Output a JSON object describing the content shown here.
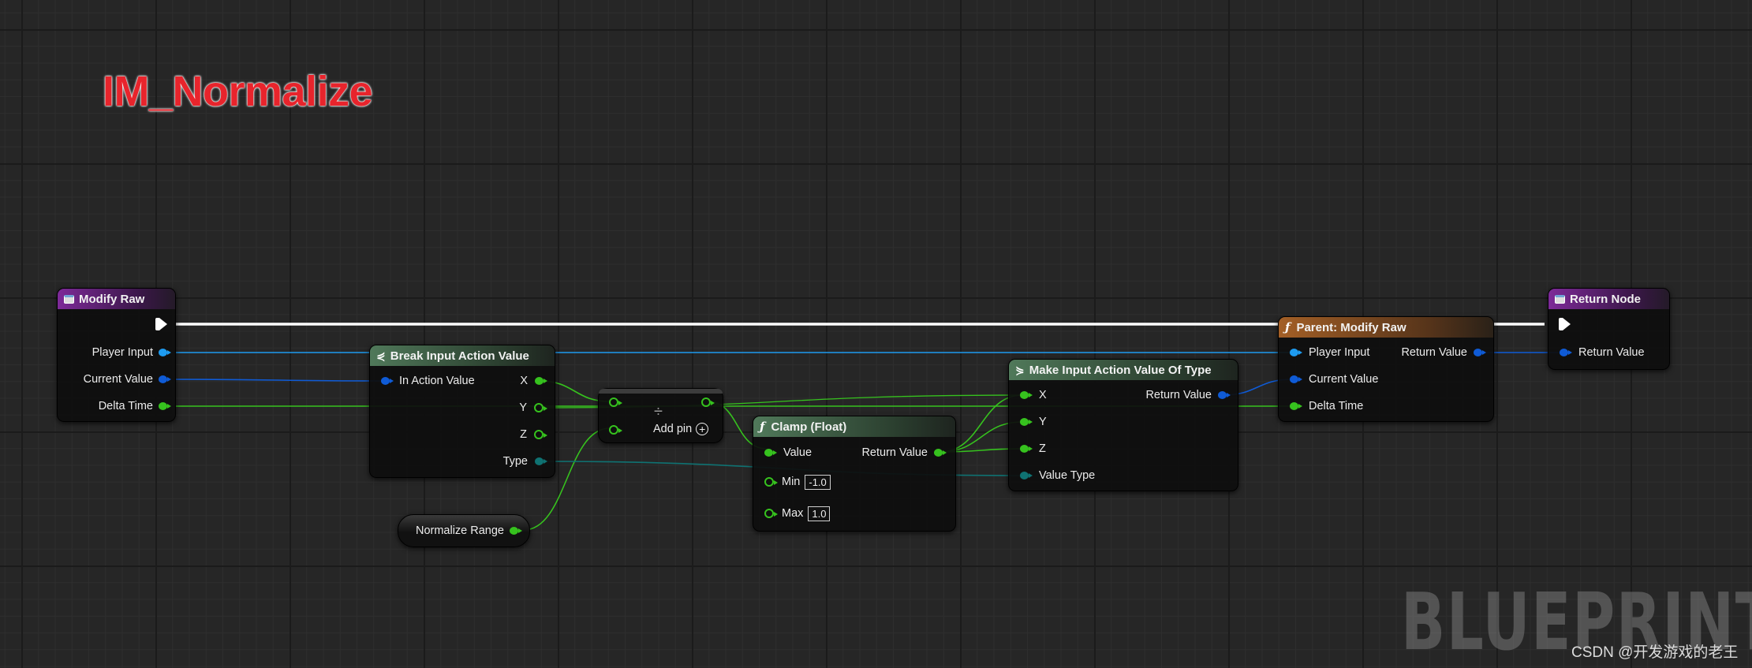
{
  "comment_title": "IM_Normalize",
  "watermark": "BLUEPRINT",
  "credit": "CSDN @开发游戏的老王",
  "colors": {
    "struct_pin": "#1e9bf0",
    "vector_pin": "#0f5bd6",
    "float_pin": "#36c21e",
    "enum_pin": "#0f7272",
    "exec": "#ffffff",
    "comment": "#e8242c"
  },
  "nodes": {
    "modify_raw": {
      "title": "Modify Raw",
      "icon": "function-entry-icon",
      "outputs": [
        "Player Input",
        "Current Value",
        "Delta Time"
      ]
    },
    "break_input": {
      "title": "Break Input Action Value",
      "icon": "break-struct-icon",
      "input": "In Action Value",
      "outputs": [
        "X",
        "Y",
        "Z",
        "Type"
      ]
    },
    "divide": {
      "symbol": "÷",
      "add_pin": "Add pin"
    },
    "normalize_range": {
      "label": "Normalize Range"
    },
    "clamp": {
      "title": "Clamp (Float)",
      "icon": "function-icon",
      "inputs": [
        "Value",
        "Min",
        "Max"
      ],
      "output": "Return Value",
      "min_value": "-1.0",
      "max_value": "1.0"
    },
    "make_input": {
      "title": "Make Input Action Value Of Type",
      "icon": "make-struct-icon",
      "inputs": [
        "X",
        "Y",
        "Z",
        "Value Type"
      ],
      "output": "Return Value"
    },
    "parent": {
      "title": "Parent: Modify Raw",
      "icon": "function-icon",
      "inputs": [
        "Player Input",
        "Current Value",
        "Delta Time"
      ],
      "output": "Return Value"
    },
    "return_node": {
      "title": "Return Node",
      "icon": "function-entry-icon",
      "input": "Return Value"
    }
  }
}
